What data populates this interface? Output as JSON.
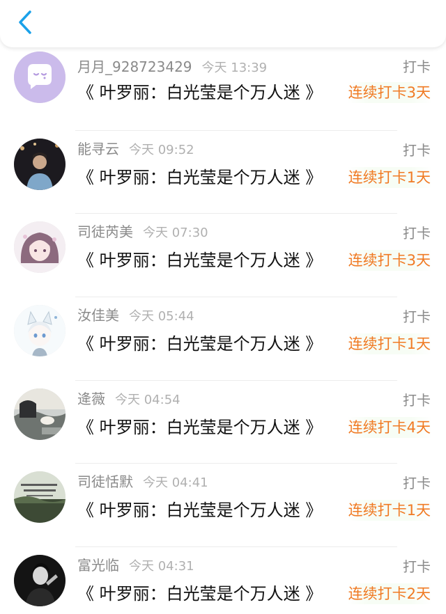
{
  "header": {
    "back_icon": "chevron-left-icon",
    "accent": "#1aa1e9"
  },
  "feed": [
    {
      "name": "月月_928723429",
      "time": "今天 13:39",
      "book": "《 叶罗丽：白光莹是个万人迷 》",
      "action": "打卡",
      "streak": "连续打卡3天",
      "avatar": "chat-bubble-avatar"
    },
    {
      "name": "能寻云",
      "time": "今天 09:52",
      "book": "《 叶罗丽：白光莹是个万人迷 》",
      "action": "打卡",
      "streak": "连续打卡1天",
      "avatar": "photo-avatar"
    },
    {
      "name": "司徒芮美",
      "time": "今天 07:30",
      "book": "《 叶罗丽：白光莹是个万人迷 》",
      "action": "打卡",
      "streak": "连续打卡3天",
      "avatar": "anime-girl-avatar"
    },
    {
      "name": "汝佳美",
      "time": "今天 05:44",
      "book": "《 叶罗丽：白光莹是个万人迷 》",
      "action": "打卡",
      "streak": "连续打卡1天",
      "avatar": "anime-cat-avatar"
    },
    {
      "name": "逄薇",
      "time": "今天 04:54",
      "book": "《 叶罗丽：白光莹是个万人迷 》",
      "action": "打卡",
      "streak": "连续打卡4天",
      "avatar": "photo-avatar"
    },
    {
      "name": "司徒恬默",
      "time": "今天 04:41",
      "book": "《 叶罗丽：白光莹是个万人迷 》",
      "action": "打卡",
      "streak": "连续打卡1天",
      "avatar": "calligraphy-avatar"
    },
    {
      "name": "富光临",
      "time": "今天 04:31",
      "book": "《 叶罗丽：白光莹是个万人迷 》",
      "action": "打卡",
      "streak": "连续打卡2天",
      "avatar": "dark-photo-avatar"
    }
  ],
  "colors": {
    "streak": "#f07a24",
    "meta": "#8a8a8a",
    "title": "#111111"
  }
}
